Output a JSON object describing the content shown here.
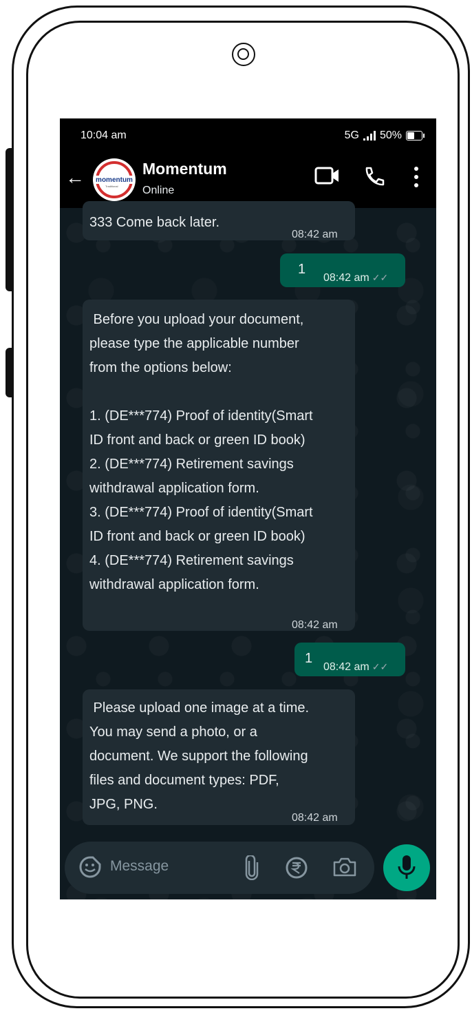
{
  "status_bar": {
    "time": "10:04 am",
    "network": "5G",
    "battery": "50%"
  },
  "header": {
    "name": "Momentum",
    "status": "Online",
    "avatar_text": "momentum",
    "avatar_subtext": "Traditional"
  },
  "messages": [
    {
      "dir": "in",
      "lines": [
        "333 Come back later."
      ],
      "time": "08:42 am"
    },
    {
      "dir": "out",
      "text": "1",
      "time": "08:42 am"
    },
    {
      "dir": "in",
      "lines": [
        " Before you upload your document,",
        "please type the applicable number",
        "from the options below:",
        "",
        "1. (DE***774) Proof of identity(Smart",
        "ID front and back or green ID book)",
        "2. (DE***774) Retirement savings",
        "withdrawal application form.",
        "3. (DE***774) Proof of identity(Smart",
        "ID front and back or green ID book)",
        "4. (DE***774) Retirement savings",
        "withdrawal application form."
      ],
      "time": "08:42 am"
    },
    {
      "dir": "out",
      "text": "1",
      "time": "08:42 am"
    },
    {
      "dir": "in",
      "lines": [
        " Please upload one image at a time.",
        "You may send a photo, or a",
        "document. We support the following",
        "files and document types: PDF,",
        "JPG, PNG."
      ],
      "time": "08:42 am"
    }
  ],
  "input": {
    "placeholder": "Message"
  },
  "colors": {
    "incoming": "#202c33",
    "outgoing": "#005c4b",
    "accent": "#00a884",
    "brand": "#d32f2f"
  }
}
